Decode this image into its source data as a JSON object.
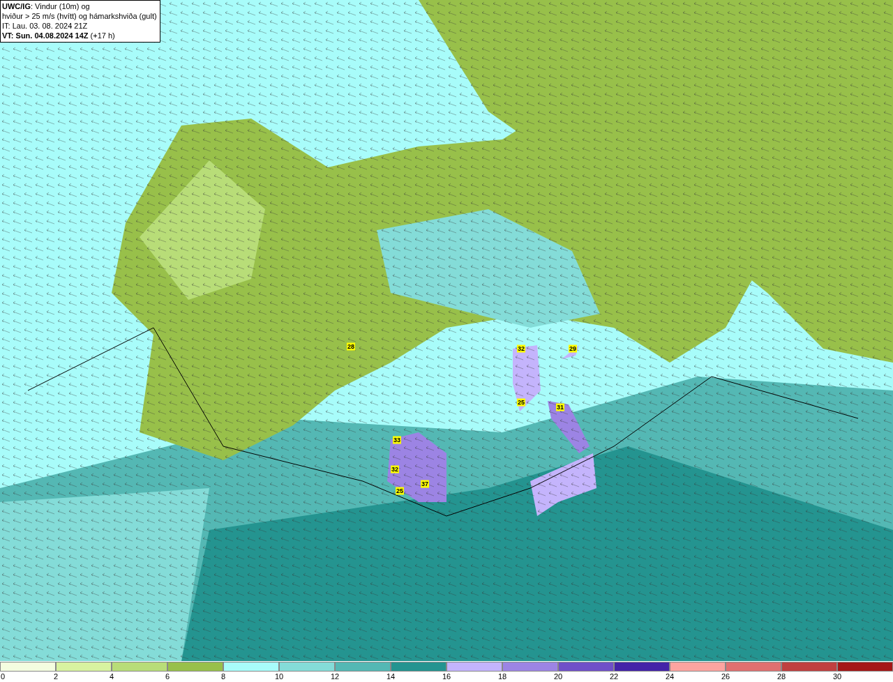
{
  "title_box": {
    "lines": [
      "**UWC/IG**: Vindur (10m) og",
      "hviður > 25 m/s (hvítt) og hámarkshviða (gult)",
      "IT: Lau. 03. 08. 2024 21Z",
      "**VT: Sun. 04.08.2024 14Z** (+17 h)"
    ]
  },
  "map": {
    "gust_labels": [
      "28",
      "32",
      "29",
      "25",
      "31",
      "33",
      "32",
      "37",
      "25"
    ]
  },
  "legend": {
    "bins": [
      {
        "color": "#f4fde0"
      },
      {
        "color": "#d8f3a0"
      },
      {
        "color": "#b8dd78"
      },
      {
        "color": "#98c04a"
      },
      {
        "color": "#a8fcfa"
      },
      {
        "color": "#84dcd8"
      },
      {
        "color": "#54b8b4"
      },
      {
        "color": "#249490"
      },
      {
        "color": "#c4b4fc"
      },
      {
        "color": "#9c84e4"
      },
      {
        "color": "#7050c8"
      },
      {
        "color": "#4424a8"
      },
      {
        "color": "#fca4a0"
      },
      {
        "color": "#e07070"
      },
      {
        "color": "#c04040"
      },
      {
        "color": "#a41818"
      }
    ],
    "ticks": [
      "0",
      "2",
      "4",
      "6",
      "8",
      "10",
      "12",
      "14",
      "16",
      "18",
      "20",
      "22",
      "24",
      "26",
      "28",
      "30"
    ]
  }
}
